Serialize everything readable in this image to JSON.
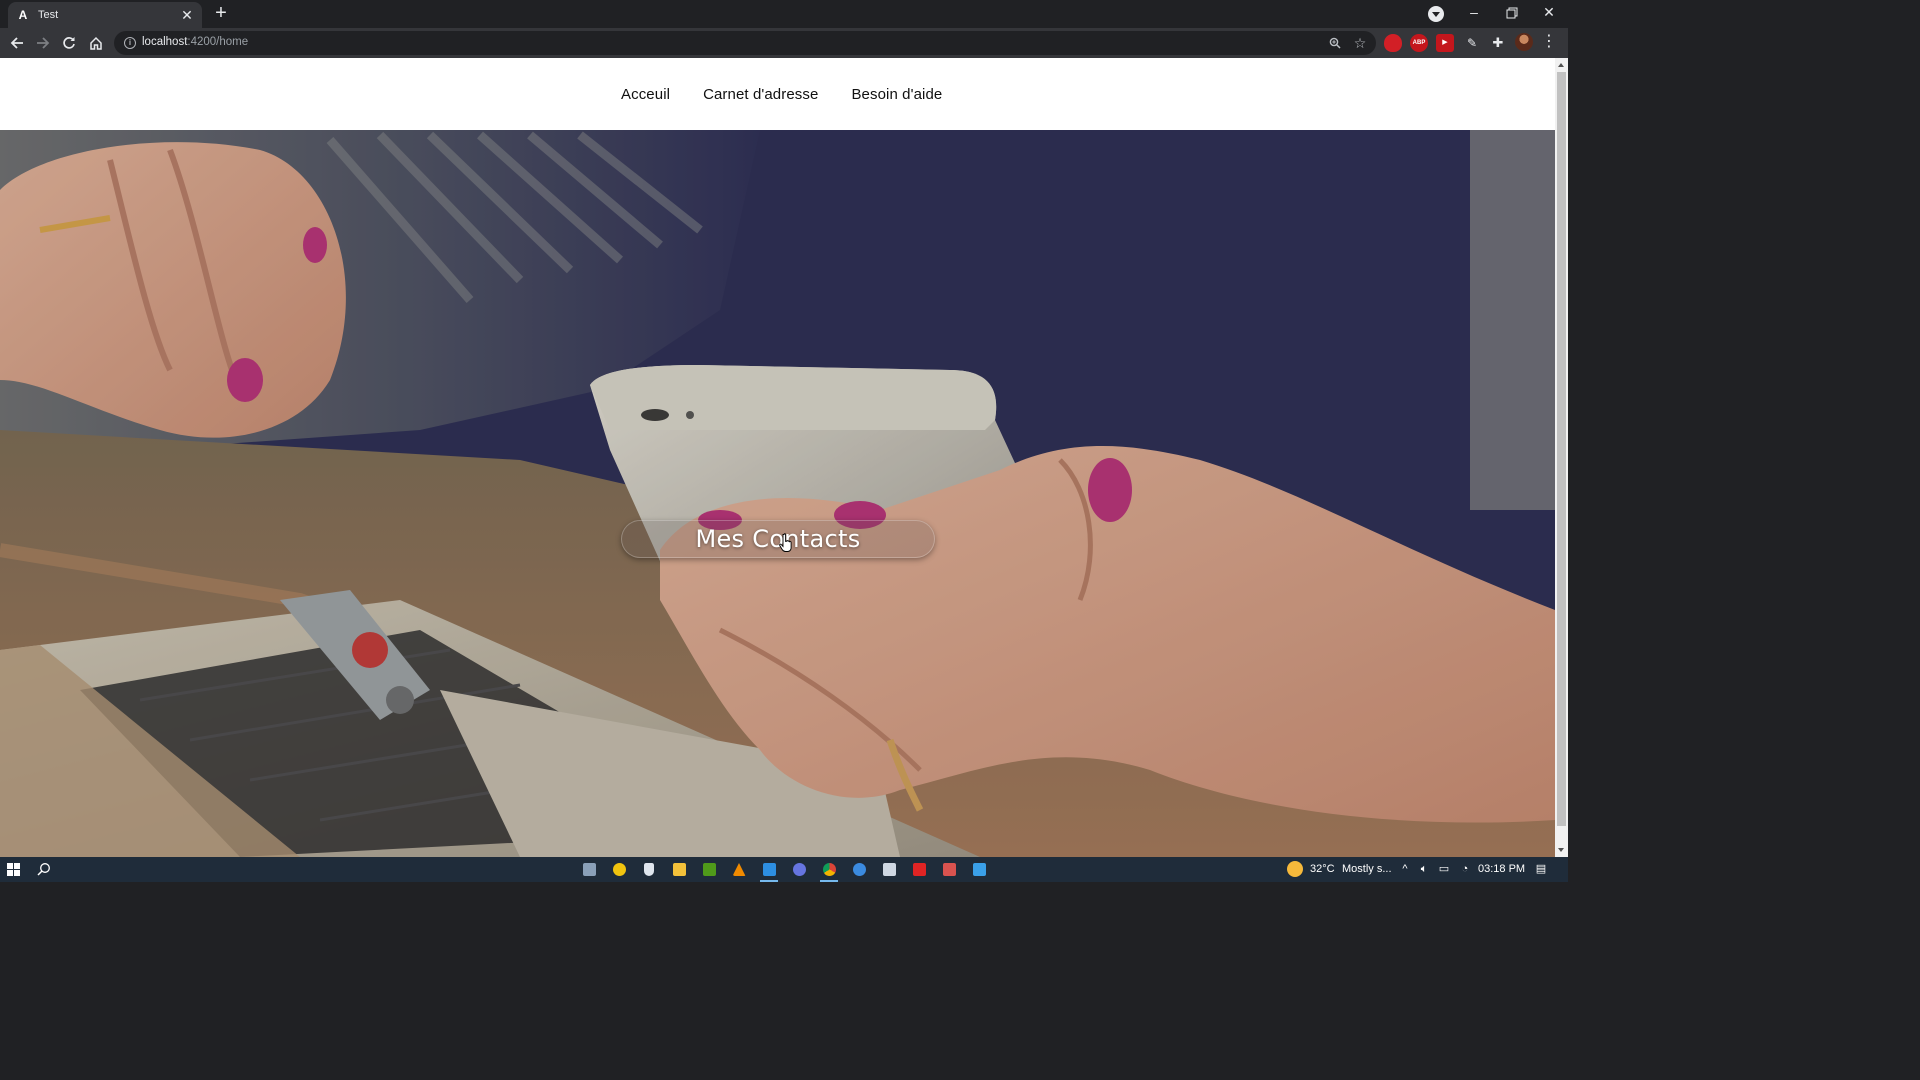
{
  "browser": {
    "tab_title": "Test",
    "tab_favicon_letter": "A",
    "url_host": "localhost",
    "url_port_path": ":4200/home"
  },
  "site": {
    "nav": [
      "Acceuil",
      "Carnet d'adresse",
      "Besoin d'aide"
    ],
    "cta_label": "Mes Contacts"
  },
  "taskbar": {
    "weather_temp": "32°C",
    "weather_desc": "Mostly s...",
    "clock": "03:18 PM"
  },
  "colors": {
    "browser_frame": "#202124",
    "toolbar": "#35363a",
    "taskbar": "#1f2c3a",
    "hero_backdrop": "#2a2c53",
    "nail_polish": "#b8327a"
  },
  "icons": {
    "tab": [
      "angular-favicon-icon",
      "close-icon",
      "plus-icon",
      "tab-search-icon"
    ],
    "window": [
      "minimize-icon",
      "restore-icon",
      "close-window-icon"
    ],
    "toolbar": [
      "back-icon",
      "forward-icon",
      "reload-icon",
      "home-icon",
      "site-info-icon",
      "zoom-icon",
      "bookmark-star-icon",
      "extensions-puzzle-icon",
      "profile-avatar",
      "menu-dots-icon"
    ],
    "taskbar": [
      "windows-start-icon",
      "search-icon",
      "weather-icon",
      "chevron-up-icon",
      "volume-icon",
      "battery-icon",
      "wifi-icon",
      "notifications-icon"
    ]
  }
}
